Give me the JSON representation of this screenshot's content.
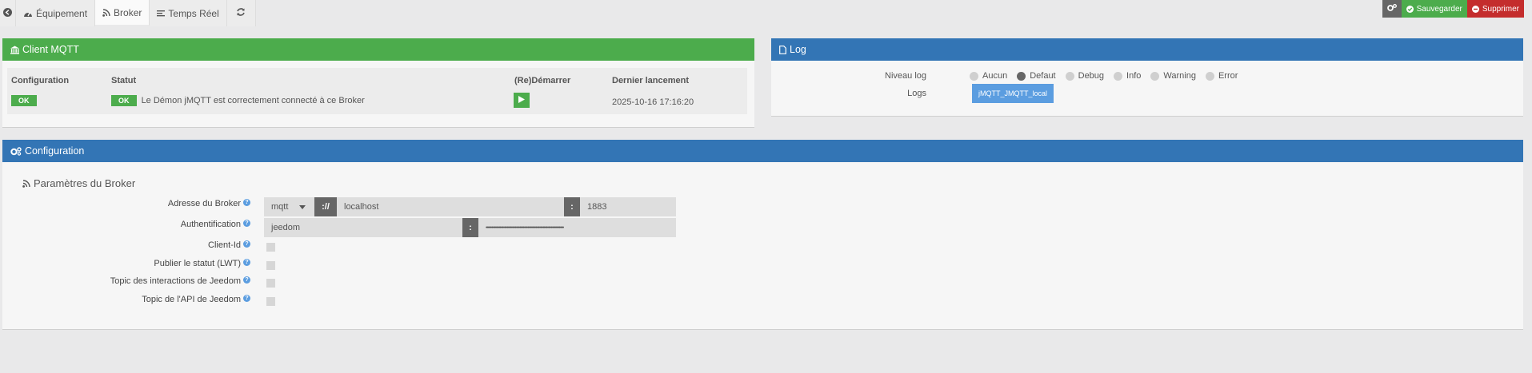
{
  "tabs": {
    "equipment": "Équipement",
    "broker": "Broker",
    "realtime": "Temps Réel"
  },
  "actions": {
    "save": "Sauvegarder",
    "delete": "Supprimer"
  },
  "mqtt_panel": {
    "title": "Client MQTT",
    "headers": {
      "configuration": "Configuration",
      "status": "Statut",
      "restart": "(Re)Démarrer",
      "last_launch": "Dernier lancement"
    },
    "row": {
      "config_badge": "OK",
      "status_badge": "OK",
      "status_text": "Le Démon jMQTT est correctement connecté à ce Broker",
      "last_launch": "2025-10-16 17:16:20"
    }
  },
  "log_panel": {
    "title": "Log",
    "level_label": "Niveau log",
    "levels": [
      "Aucun",
      "Defaut",
      "Debug",
      "Info",
      "Warning",
      "Error"
    ],
    "selected_level": "Defaut",
    "logs_label": "Logs",
    "log_button": "jMQTT_JMQTT_local"
  },
  "config_panel": {
    "title": "Configuration",
    "section": "Paramètres du Broker",
    "fields": {
      "address_label": "Adresse du Broker",
      "protocol": "mqtt",
      "proto_sep": "://",
      "host": "localhost",
      "port_sep": ":",
      "port": "1883",
      "auth_label": "Authentification",
      "user": "jeedom",
      "auth_sep": ":",
      "password_mask": "•••••••••••••••••••••••••••••••••••••••••••••••••••••••••••••••••••",
      "client_id_label": "Client-Id",
      "lwt_label": "Publier le statut (LWT)",
      "interactions_label": "Topic des interactions de Jeedom",
      "api_label": "Topic de l'API de Jeedom"
    }
  },
  "colors": {
    "green": "#4cac4c",
    "blue": "#3375b5",
    "red": "#c42d2d"
  }
}
